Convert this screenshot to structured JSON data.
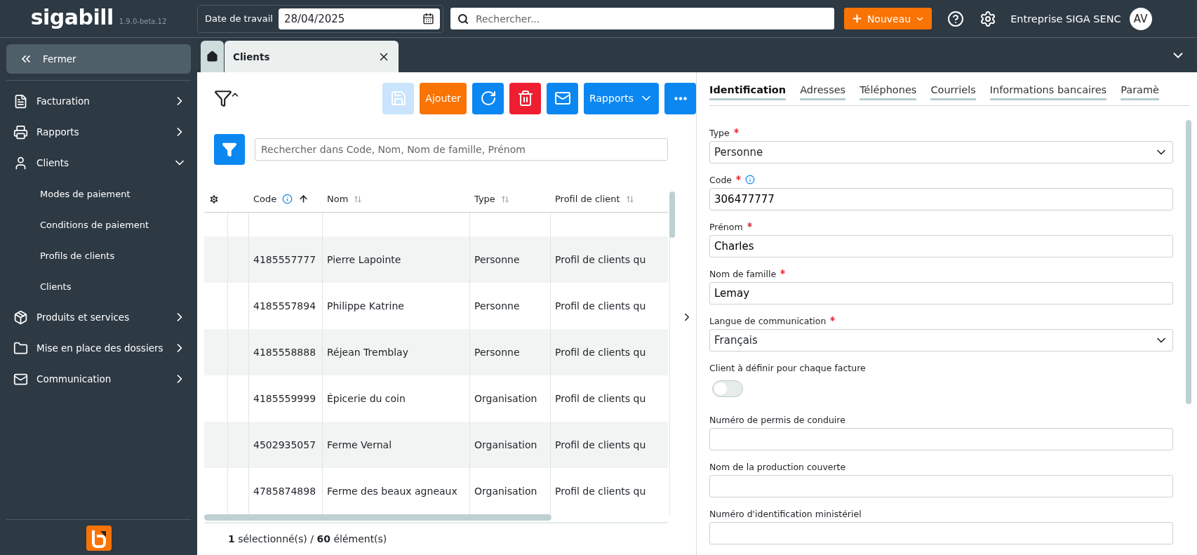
{
  "header": {
    "logo": "siga**bill**",
    "version": "1.9.0-beta.12",
    "work_date": {
      "label": "Date de travail",
      "value": "28/04/2025"
    },
    "search": {
      "placeholder": "Rechercher..."
    },
    "new_button": "Nouveau",
    "company": "Entreprise SIGA SENC",
    "avatar": "AV"
  },
  "sidebar": {
    "close_button": "Fermer",
    "items": [
      {
        "label": "Facturation",
        "expanded": false
      },
      {
        "label": "Rapports",
        "expanded": false
      },
      {
        "label": "Clients",
        "expanded": true,
        "children": [
          {
            "label": "Modes de paiement"
          },
          {
            "label": "Conditions de paiement"
          },
          {
            "label": "Profils de clients"
          },
          {
            "label": "Clients"
          }
        ]
      },
      {
        "label": "Produits et services",
        "expanded": false
      },
      {
        "label": "Mise en place des dossiers",
        "expanded": false
      },
      {
        "label": "Communication",
        "expanded": false
      }
    ]
  },
  "tabs": [
    {
      "label": "Clients",
      "selected": true
    }
  ],
  "toolbar": {
    "buttons": [
      {
        "kind": "save",
        "disabled": true
      },
      {
        "kind": "add",
        "label": "Ajouter",
        "disabled": false
      },
      {
        "kind": "refresh",
        "disabled": false
      },
      {
        "kind": "delete",
        "disabled": false
      },
      {
        "kind": "mail",
        "disabled": false
      },
      {
        "kind": "dropdown",
        "label": "Rapports",
        "disabled": false
      },
      {
        "kind": "more",
        "disabled": false
      }
    ]
  },
  "table_search": {
    "placeholder": "Rechercher dans Code, Nom, Nom de famille, Prénom"
  },
  "table": {
    "columns": [
      {
        "label": "Code",
        "info": true,
        "sorted_ascending": true
      },
      {
        "label": "Nom",
        "info": false,
        "sorted_ascending": false
      },
      {
        "label": "Type",
        "info": false,
        "sorted_ascending": false
      },
      {
        "label": "Profil de client",
        "info": false,
        "sorted_ascending": false
      }
    ],
    "rows": [
      [
        "4185557777",
        "Pierre Lapointe",
        "Personne",
        "Profil de clients qu"
      ],
      [
        "4185557894",
        "Philippe Katrine",
        "Personne",
        "Profil de clients qu"
      ],
      [
        "4185558888",
        "Réjean Tremblay",
        "Personne",
        "Profil de clients qu"
      ],
      [
        "4185559999",
        "Épicerie du coin",
        "Organisation",
        "Profil de clients qu"
      ],
      [
        "4502935057",
        "Ferme Vernal",
        "Organisation",
        "Profil de clients qu"
      ],
      [
        "4785874898",
        "Ferme des beaux agneaux",
        "Organisation",
        "Profil de clients qu"
      ]
    ]
  },
  "table_footer": "**1** sélectionné(s)  /  **60** élément(s)",
  "detail_tabs": [
    {
      "label": "Identification",
      "selected": true
    },
    {
      "label": "Adresses",
      "selected": false
    },
    {
      "label": "Téléphones",
      "selected": false
    },
    {
      "label": "Courriels",
      "selected": false
    },
    {
      "label": "Informations bancaires",
      "selected": false
    },
    {
      "label": "Paramè",
      "selected": false
    }
  ],
  "form": [
    {
      "kind": "select",
      "label": "Type",
      "required": true,
      "info": false,
      "value": "Personne"
    },
    {
      "kind": "text",
      "label": "Code",
      "required": true,
      "info": true,
      "value": "306477777"
    },
    {
      "kind": "text",
      "label": "Prénom",
      "required": true,
      "info": false,
      "value": "Charles"
    },
    {
      "kind": "text",
      "label": "Nom de famille",
      "required": true,
      "info": false,
      "value": "Lemay"
    },
    {
      "kind": "select",
      "label": "Langue de communication",
      "required": true,
      "info": false,
      "value": "Français"
    },
    {
      "kind": "toggle",
      "label": "Client à définir pour chaque facture",
      "required": false,
      "info": false,
      "on": false
    },
    {
      "kind": "text",
      "label": "Numéro de permis de conduire",
      "required": false,
      "info": false
    },
    {
      "kind": "text",
      "label": "Nom de la production couverte",
      "required": false,
      "info": false
    },
    {
      "kind": "text",
      "label": "Numéro d'identification ministériel",
      "required": false,
      "info": false
    }
  ]
}
